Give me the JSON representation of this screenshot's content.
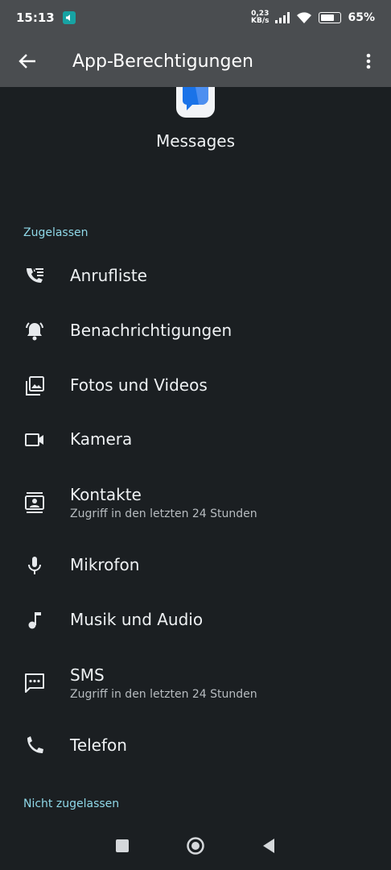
{
  "status_bar": {
    "time": "15:13",
    "speed_top": "0,23",
    "speed_bottom": "KB/s",
    "battery": "65%"
  },
  "header": {
    "title": "App-Berechtigungen"
  },
  "app": {
    "name": "Messages"
  },
  "sections": {
    "allowed": "Zugelassen",
    "not_allowed": "Nicht zugelassen"
  },
  "permissions": [
    {
      "label": "Anrufliste",
      "icon": "call-log-icon"
    },
    {
      "label": "Benachrichtigungen",
      "icon": "notification-bell-icon"
    },
    {
      "label": "Fotos und Videos",
      "icon": "photos-icon"
    },
    {
      "label": "Kamera",
      "icon": "videocam-icon"
    },
    {
      "label": "Kontakte",
      "sub": "Zugriff in den letzten 24 Stunden",
      "icon": "contacts-icon"
    },
    {
      "label": "Mikrofon",
      "icon": "microphone-icon"
    },
    {
      "label": "Musik und Audio",
      "icon": "music-note-icon"
    },
    {
      "label": "SMS",
      "sub": "Zugriff in den letzten 24 Stunden",
      "icon": "sms-icon"
    },
    {
      "label": "Telefon",
      "icon": "phone-icon"
    }
  ],
  "colors": {
    "background": "#1b1f22",
    "appbar": "#4a4d50",
    "section": "#8fd8e8"
  }
}
